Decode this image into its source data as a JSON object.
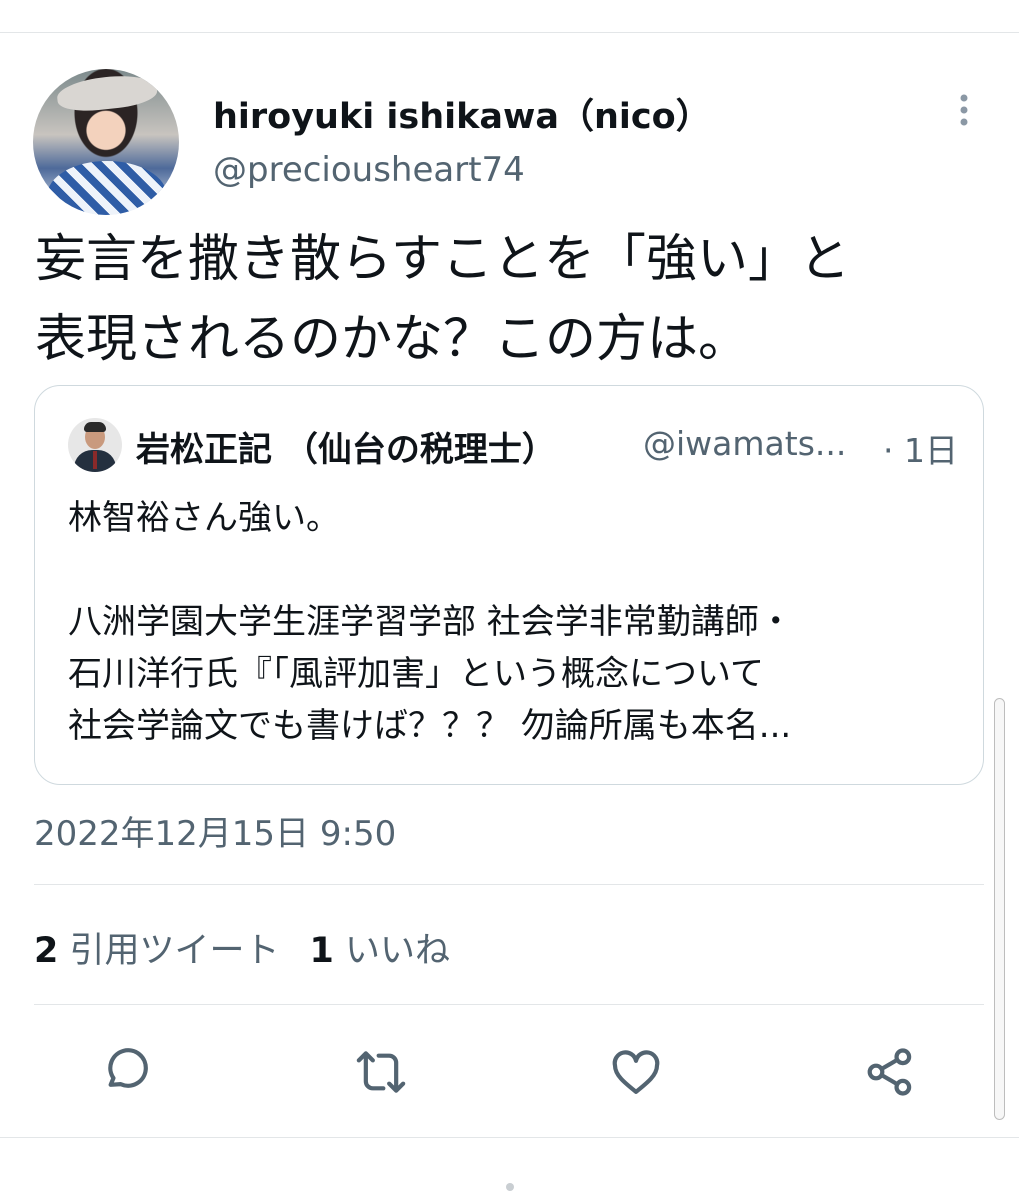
{
  "tweet": {
    "author_name": "hiroyuki ishikawa（nico）",
    "author_handle": "@preciousheart74",
    "text_line1": "妄言を撒き散らすことを「強い」と",
    "text_line2": "表現されるのかな？この方は。",
    "timestamp": "2022年12月15日 9:50"
  },
  "quoted": {
    "author_name": "岩松正記 （仙台の税理士）",
    "author_handle": "@iwamats...",
    "time": "· 1日",
    "line1": "林智裕さん強い。",
    "line2": "八洲学園大学生涯学習学部 社会学非常勤講師・",
    "line3": "石川洋行氏『「風評加害」という概念について",
    "line4": "社会学論文でも書けば？？？ 勿論所属も本名..."
  },
  "stats": {
    "quote_count": "2",
    "quote_label": "引用ツイート",
    "like_count": "1",
    "like_label": "いいね"
  },
  "icons": {
    "more": "more-vertical-icon",
    "reply": "reply-icon",
    "retweet": "retweet-icon",
    "like": "like-icon",
    "share": "share-icon"
  },
  "colors": {
    "text": "#0f1419",
    "secondary": "#536471",
    "border": "#cfd9de"
  }
}
